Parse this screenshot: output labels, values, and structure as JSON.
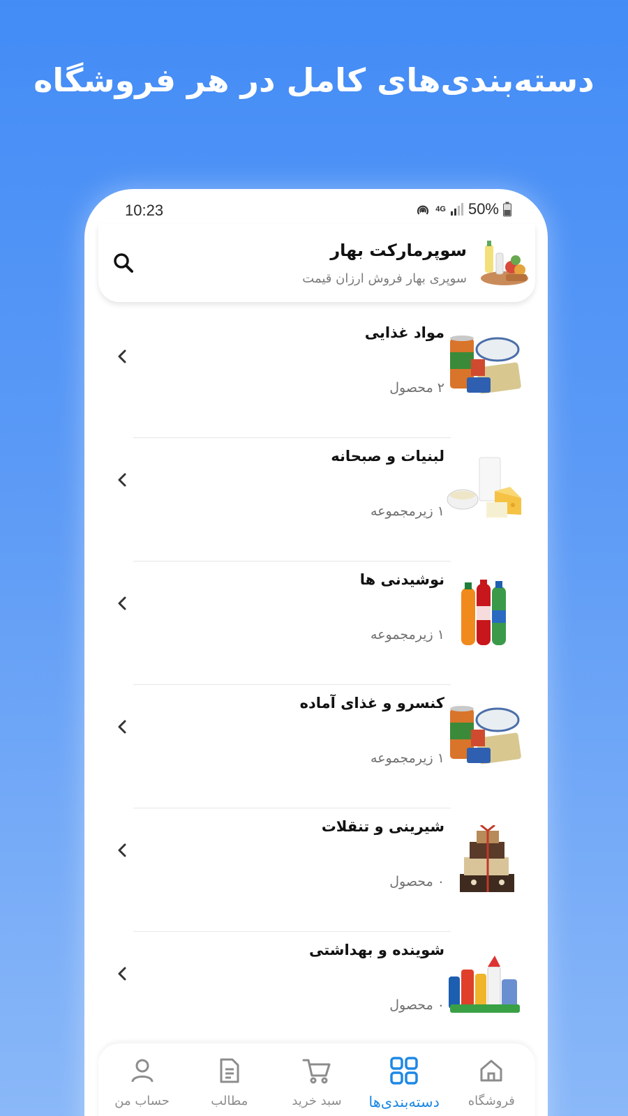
{
  "promo": {
    "title": "دسته‌بندی‌های کامل در هر فروشگاه"
  },
  "status_bar": {
    "time": "10:23",
    "network": "4G",
    "battery": "50%"
  },
  "header": {
    "store_name": "سوپرمارکت بهار",
    "tagline": "سوپری بهار فروش ارزان قیمت",
    "logo_icon": "grocery-basket-image",
    "search_icon": "search-icon"
  },
  "categories": [
    {
      "title": "مواد غذایی",
      "subtitle": "۲ محصول",
      "image": "canned-food-image"
    },
    {
      "title": "لبنیات و صبحانه",
      "subtitle": "۱ زیرمجموعه",
      "image": "dairy-image"
    },
    {
      "title": "نوشیدنی ها",
      "subtitle": "۱ زیرمجموعه",
      "image": "soda-bottles-image"
    },
    {
      "title": "کنسرو و غذای آماده",
      "subtitle": "۱ زیرمجموعه",
      "image": "canned-food-image"
    },
    {
      "title": "شیرینی و تنقلات",
      "subtitle": "۰ محصول",
      "image": "sweets-box-image"
    },
    {
      "title": "شوینده و بهداشتی",
      "subtitle": "۰ محصول",
      "image": "detergent-image"
    }
  ],
  "bottom_nav": [
    {
      "label": "فروشگاه",
      "icon": "home-icon",
      "active": false
    },
    {
      "label": "دسته‌بندی‌ها",
      "icon": "grid-icon",
      "active": true
    },
    {
      "label": "سبد خرید",
      "icon": "cart-icon",
      "active": false
    },
    {
      "label": "مطالب",
      "icon": "document-icon",
      "active": false
    },
    {
      "label": "حساب من",
      "icon": "user-icon",
      "active": false
    }
  ],
  "colors": {
    "accent": "#1e88e5",
    "background_top": "#438cf6",
    "background_bottom": "#8ab8f8"
  }
}
